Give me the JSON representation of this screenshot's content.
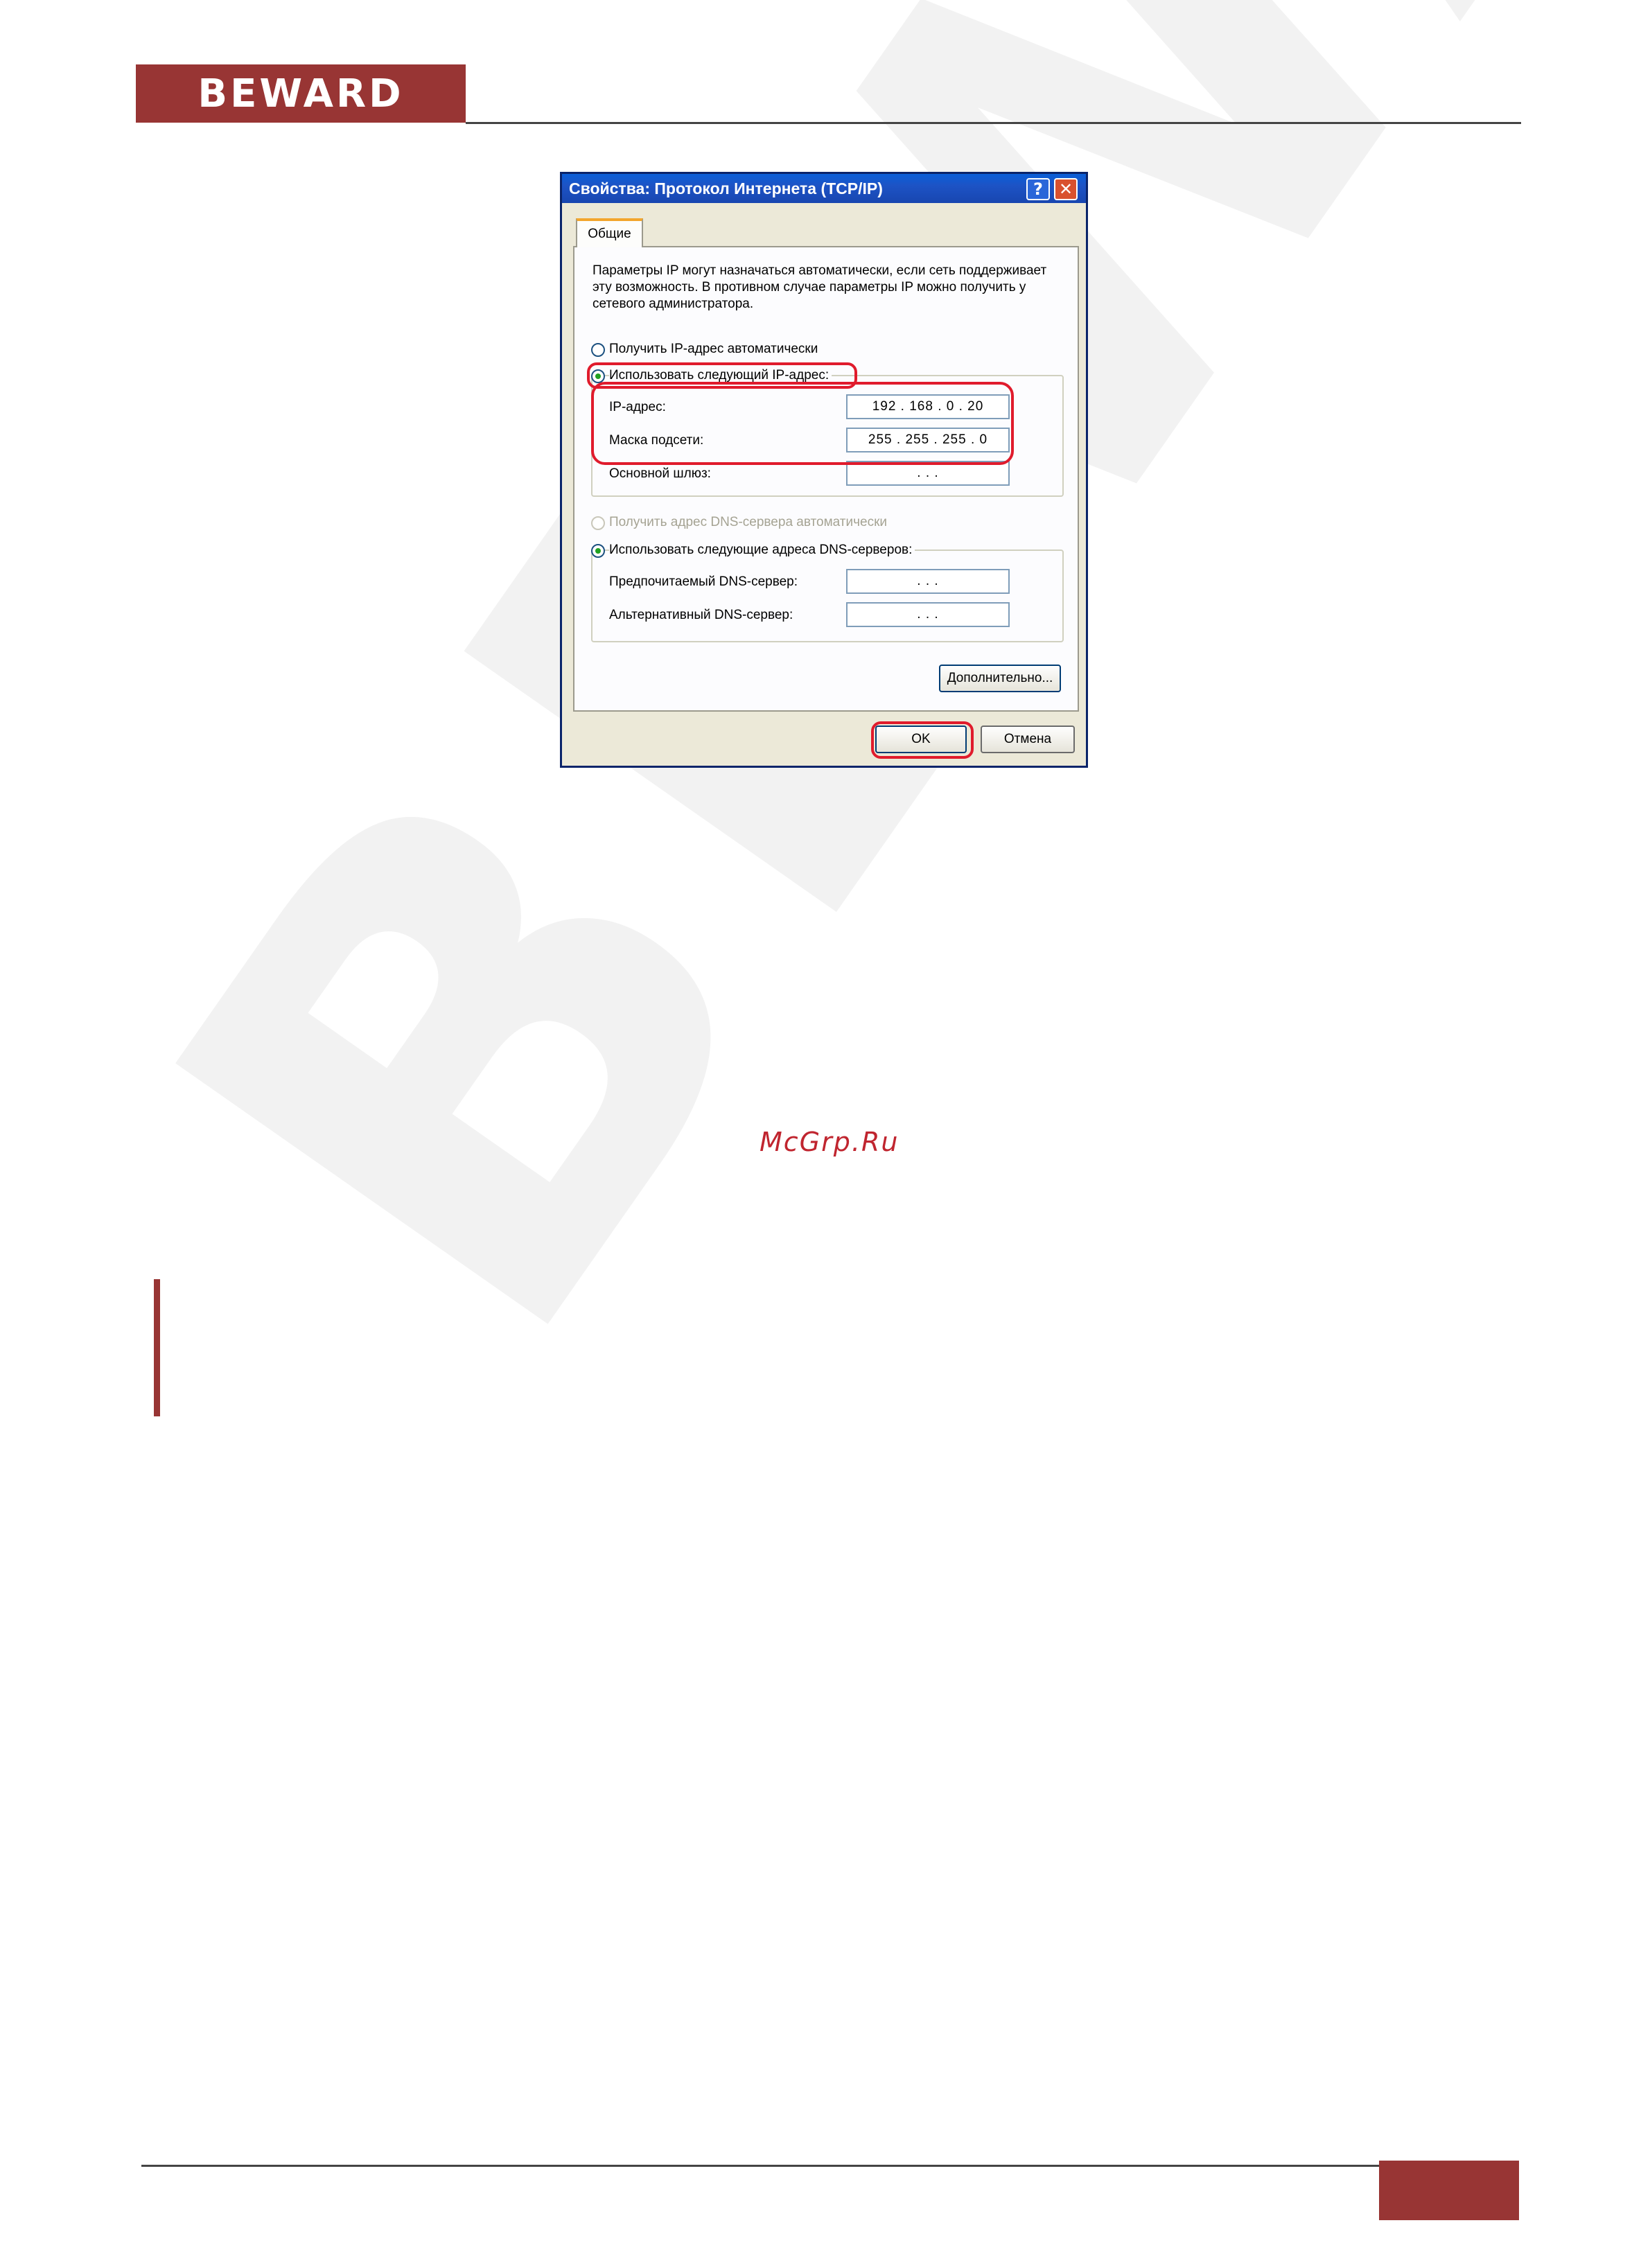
{
  "header": {
    "logo_text": "BEWARD"
  },
  "dialog": {
    "title": "Свойства: Протокол Интернета (TCP/IP)",
    "help_label": "?",
    "close_label": "✕",
    "tab_label": "Общие",
    "description": "Параметры IP могут назначаться автоматически, если сеть поддерживает эту возможность. В противном случае параметры IP можно получить у сетевого администратора.",
    "radio_auto_ip": "Получить IP-адрес автоматически",
    "radio_manual_ip": "Использовать следующий IP-адрес:",
    "ip_label": "IP-адрес:",
    "ip_value": "192 . 168 .  0  . 20",
    "mask_label": "Маска подсети:",
    "mask_value": "255 . 255 . 255 .  0",
    "gateway_label": "Основной шлюз:",
    "gateway_value": ".     .     .",
    "radio_auto_dns": "Получить адрес DNS-сервера автоматически",
    "radio_manual_dns": "Использовать следующие адреса DNS-серверов:",
    "dns_pref_label": "Предпочитаемый DNS-сервер:",
    "dns_pref_value": ".     .     .",
    "dns_alt_label": "Альтернативный DNS-сервер:",
    "dns_alt_value": ".     .     .",
    "advanced_button": "Дополнительно...",
    "ok_button": "OK",
    "cancel_button": "Отмена"
  },
  "watermark": {
    "text": "McGrp.Ru"
  },
  "colors": {
    "brand": "#983534",
    "highlight": "#e01b2c"
  }
}
